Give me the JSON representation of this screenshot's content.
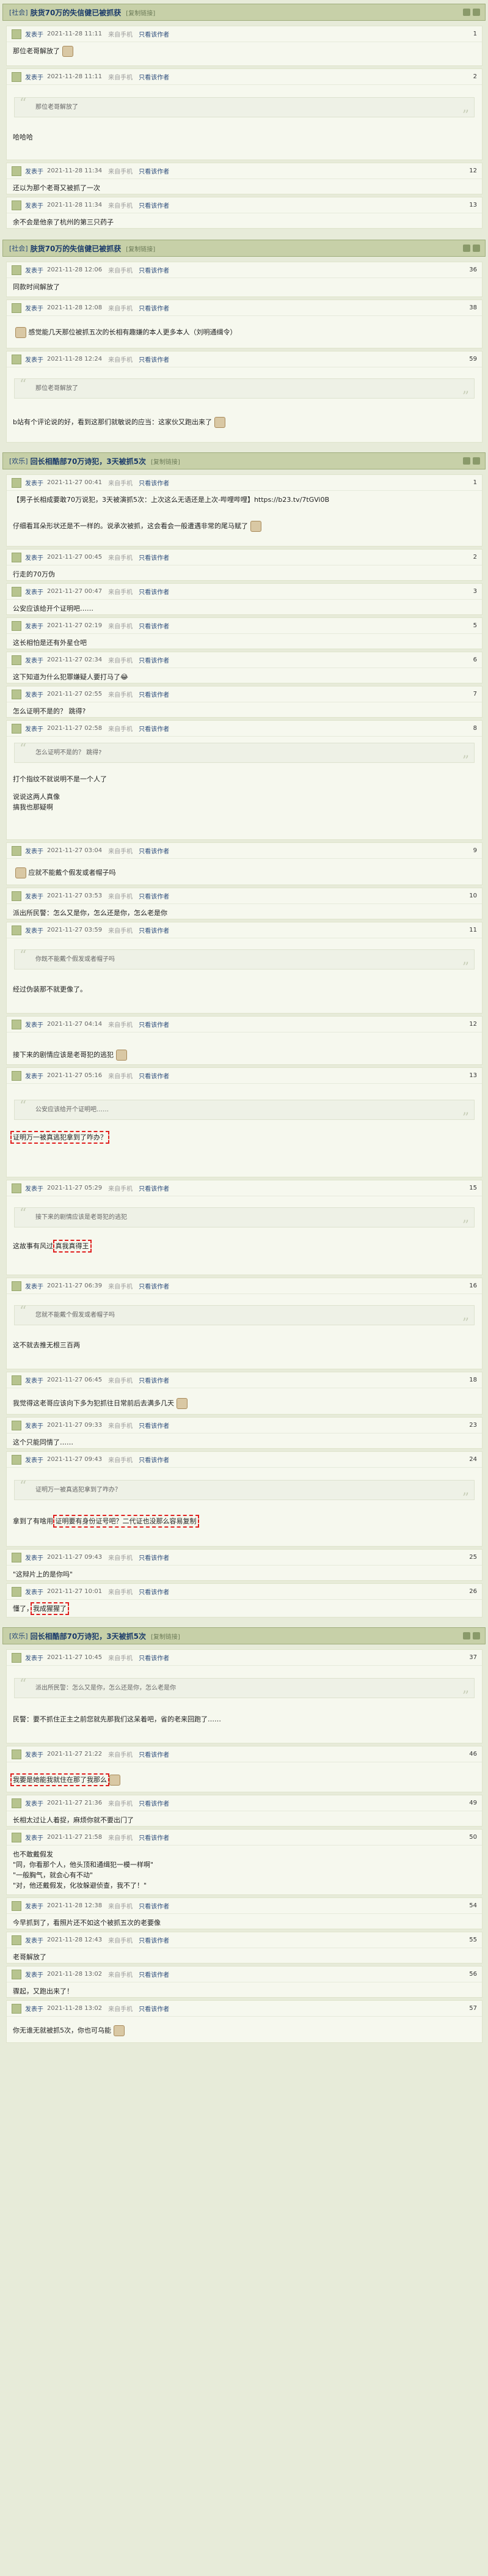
{
  "header1": {
    "tag": "[社会]",
    "title": "肤货70万的失信健已被抓获",
    "sub": "[复制链接]"
  },
  "header2": {
    "tag": "[社会]",
    "title": "肤货70万的失信健已被抓获",
    "sub": "[复制链接]"
  },
  "header3": {
    "tag": "[欢乐]",
    "title": "回长相酷部70万诗犯，3天被抓5次",
    "sub": "[复制链接]"
  },
  "header4": {
    "tag": "[欢乐]",
    "title": "回长相酷部70万诗犯，3天被抓5次",
    "sub": "[复制链接]"
  },
  "common": {
    "src": "来自手机",
    "only": "只看该作者",
    "user_prefix": "发表于"
  },
  "posts": [
    {
      "time": "2021-11-28 11:11",
      "floor": "1",
      "text": "那位老哥解放了"
    },
    {
      "time": "2021-11-28 11:11",
      "floor": "2",
      "quote": "那位老哥解放了",
      "text": "哈哈哈"
    },
    {
      "time": "2021-11-28 11:34",
      "floor": "12",
      "text": "还以为那个老哥又被抓了一次"
    },
    {
      "time": "2021-11-28 11:34",
      "floor": "13",
      "text": "余不会是他亲了杭州的第三只药子"
    },
    {
      "time": "2021-11-28 12:06",
      "floor": "36",
      "text": "同款时间解放了"
    },
    {
      "time": "2021-11-28 12:08",
      "floor": "38",
      "text": "感觉能几天那位被抓五次的长相有趣嫌的本人更多本人（刘明通缉令）"
    },
    {
      "time": "2021-11-28 12:24",
      "floor": "59",
      "quote": "那位老哥解放了",
      "text": "b站有个评论说的好，看到这那们就敏说的应当：这家伙又跑出来了"
    },
    {
      "time": "2021-11-27 00:41",
      "floor": "1",
      "text": "【男子长相成要敢70万说犯，3天被演抓5次：上次这么无语还是上次-哔哩哔哩】https://b23.tv/7tGVi0B",
      "text2": "仔细看耳朵形状还是不一样的。说承次被抓，这会看会一般遭遇非常的尾马赋了"
    },
    {
      "time": "2021-11-27 00:45",
      "floor": "2",
      "text": "行走的70万伪"
    },
    {
      "time": "2021-11-27 00:47",
      "floor": "3",
      "text": "公安应该给开个证明吧……"
    },
    {
      "time": "2021-11-27 02:19",
      "floor": "5",
      "text": "这长相怕是还有外星仓吧"
    },
    {
      "time": "2021-11-27 02:34",
      "floor": "6",
      "text": "这下知道为什么犯罪嫌疑人要打马了😂"
    },
    {
      "time": "2021-11-27 02:55",
      "floor": "7",
      "text": "怎么证明不是的？ 跳得?"
    },
    {
      "time": "2021-11-27 02:58",
      "floor": "8",
      "quote": "怎么证明不是的？ 跳得?",
      "text": "打个指纹不就说明不是一个人了",
      "text2": "说说这两人真像\n搞我也那疑啊"
    },
    {
      "time": "2021-11-27 03:04",
      "floor": "9",
      "text": "应就不能戴个假发或者帽子吗"
    },
    {
      "time": "2021-11-27 03:53",
      "floor": "10",
      "text": "派出所民警：怎么又是你，怎么还是你，怎么老是你"
    },
    {
      "time": "2021-11-27 03:59",
      "floor": "11",
      "quote": "你既不能戴个假发或者帽子吗",
      "text": "经过伪装那不就更像了。"
    },
    {
      "time": "2021-11-27 04:14",
      "floor": "12",
      "text": "接下来的剧情应该是老哥犯的逃犯"
    },
    {
      "time": "2021-11-27 05:16",
      "floor": "13",
      "quote": "公安应该给开个证明吧……",
      "text": "证明万一被真逃犯拿到了咋办？"
    },
    {
      "time": "2021-11-27 05:29",
      "floor": "15",
      "quote": "接下来的剧情应该是老哥犯的逃犯",
      "text": "这故事有风过",
      "hl": "真我真得王"
    },
    {
      "time": "2021-11-27 06:39",
      "floor": "16",
      "quote": "您就不能戴个假发或者帽子吗",
      "text": "这不就去推无根三百两"
    },
    {
      "time": "2021-11-27 06:45",
      "floor": "18",
      "text": "我觉得这老哥应该向下多为犯抓往日常前后去满多几天"
    },
    {
      "time": "2021-11-27 09:33",
      "floor": "23",
      "text": "这个只能同情了……"
    },
    {
      "time": "2021-11-27 09:43",
      "floor": "24",
      "quote": "证明万一被真逃犯拿到了咋办？",
      "text": "拿到了有啥用",
      "hl": "证明要有身份证号吧？二代证也没那么容易复制"
    },
    {
      "time": "2021-11-27 09:43",
      "floor": "25",
      "text": "\"这辩片上的是你吗\""
    },
    {
      "time": "2021-11-27 10:01",
      "floor": "26",
      "text": "懂了，",
      "hl": "我成猩猩了"
    },
    {
      "time": "2021-11-27 10:45",
      "floor": "37",
      "quote": "派出所民警：怎么又是你，怎么还是你，怎么老是你",
      "text": "民警：要不抓住正主之前您就先那我们这呆着吧，省的老来回跑了……"
    },
    {
      "time": "2021-11-27 21:22",
      "floor": "46",
      "text": "",
      "hl": "我要是她能我就住在那了我那么"
    },
    {
      "time": "2021-11-27 21:36",
      "floor": "49",
      "text": "长相太过让人着捉，麻烦你就不要出门了"
    },
    {
      "time": "2021-11-27 21:58",
      "floor": "50",
      "text": "也不敢戴假发\n\"同，你看那个人，他头顶和通缉犯一模一样啊\"\n\"一般胸气，就会心有不动\"\n\"对，他还戴假发，化妆躲避侦查，我不了！\""
    },
    {
      "time": "2021-11-28 12:38",
      "floor": "54",
      "text": "今早抓到了，看照片还不如这个被抓五次的老要像"
    },
    {
      "time": "2021-11-28 12:43",
      "floor": "55",
      "text": "老哥解放了"
    },
    {
      "time": "2021-11-28 13:02",
      "floor": "56",
      "text": "骤起，又跑出来了！"
    },
    {
      "time": "2021-11-28 13:02",
      "floor": "57",
      "text": "你无谁无就被抓5次，你也可乌能"
    }
  ]
}
